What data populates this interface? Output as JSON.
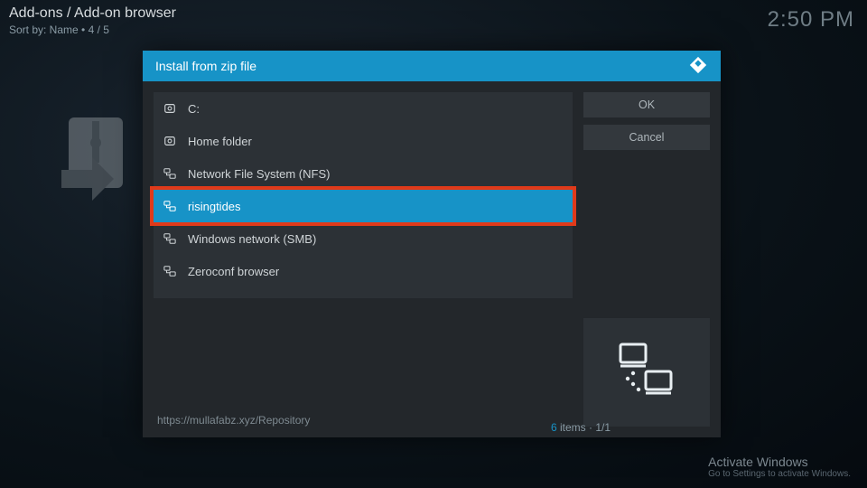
{
  "header": {
    "breadcrumb": "Add-ons / Add-on browser",
    "sort_label": "Sort by: Name",
    "position": "4 / 5",
    "clock": "2:50 PM"
  },
  "dialog": {
    "title": "Install from zip file",
    "buttons": {
      "ok": "OK",
      "cancel": "Cancel"
    },
    "footer_path": "https://mullafabz.xyz/Repository",
    "items": [
      {
        "label": "C:",
        "icon": "drive-icon",
        "selected": false
      },
      {
        "label": "Home folder",
        "icon": "drive-icon",
        "selected": false
      },
      {
        "label": "Network File System (NFS)",
        "icon": "net-icon",
        "selected": false
      },
      {
        "label": "risingtides",
        "icon": "net-icon",
        "selected": true
      },
      {
        "label": "Windows network (SMB)",
        "icon": "net-icon",
        "selected": false
      },
      {
        "label": "Zeroconf browser",
        "icon": "net-icon",
        "selected": false
      }
    ],
    "pager": {
      "count": "6",
      "items_word": "items",
      "page": "1/1"
    }
  },
  "watermark": {
    "line1": "Activate Windows",
    "line2": "Go to Settings to activate Windows."
  }
}
